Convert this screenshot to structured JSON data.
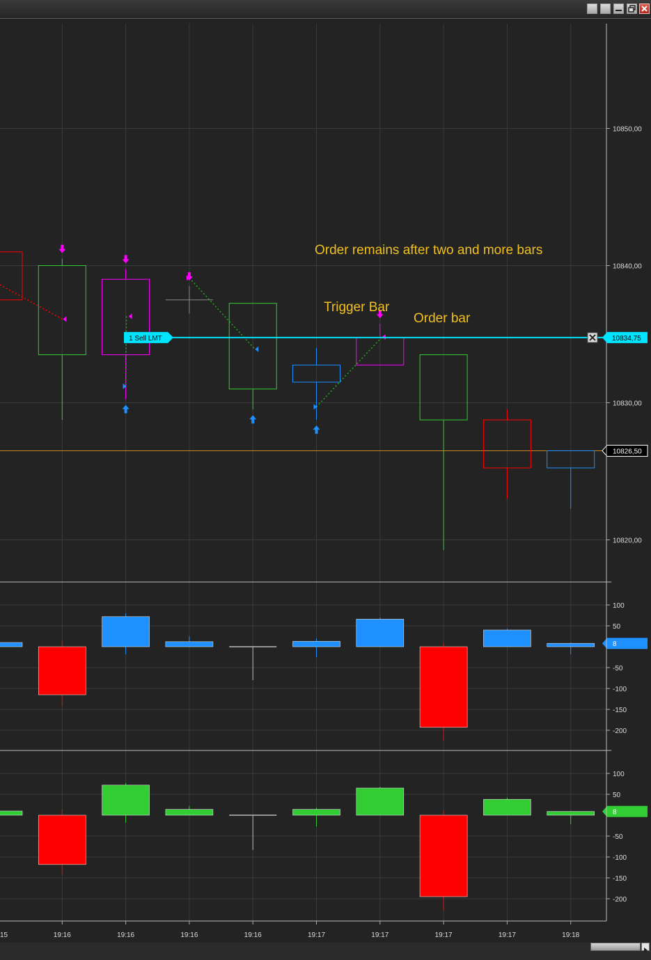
{
  "window": {
    "buttons": [
      "maximize-a",
      "maximize-b",
      "minimize",
      "restore",
      "close"
    ]
  },
  "colors": {
    "background": "#232323",
    "grid": "#3a3a3a",
    "up": "#32cd32",
    "down": "#ff0000",
    "blue": "#1e90ff",
    "magenta": "#ff00ff",
    "order_line": "#00e5ff",
    "annotation": "#f0c020",
    "last_price_line": "#c8841e"
  },
  "time_axis": {
    "labels": [
      "15",
      "19:16",
      "19:16",
      "19:16",
      "19:16",
      "19:17",
      "19:17",
      "19:17",
      "19:17",
      "19:18"
    ]
  },
  "price_axis": {
    "labels": [
      "10850,00",
      "10840,00",
      "10830,00",
      "10820,00"
    ],
    "ticks": [
      10850,
      10840,
      10830,
      10820
    ]
  },
  "annotations": {
    "order_remains": "Order remains after two and more bars",
    "trigger_bar": "Trigger Bar",
    "order_bar": "Order bar"
  },
  "order": {
    "label": "1  Sell LMT",
    "price": 10834.75,
    "price_label": "10834,75"
  },
  "last_price": {
    "value": 10826.5,
    "label": "10826,50"
  },
  "chart_data": [
    {
      "type": "candlestick",
      "name": "price",
      "x": [
        "15",
        "19:16",
        "19:16",
        "19:16",
        "19:16",
        "19:17",
        "19:17",
        "19:17",
        "19:17",
        "19:18"
      ],
      "bars": [
        {
          "open": 10837.5,
          "close": 10841,
          "high": 10841,
          "low": 10837.5,
          "color": "red"
        },
        {
          "open": 10833.5,
          "close": 10840,
          "high": 10840.5,
          "low": 10828.75,
          "color": "green"
        },
        {
          "open": 10839,
          "close": 10833.5,
          "high": 10839.75,
          "low": 10830.25,
          "color": "magenta"
        },
        {
          "open": 10837.5,
          "close": 10837.5,
          "high": 10838.5,
          "low": 10836.5,
          "color": "gray"
        },
        {
          "open": 10831,
          "close": 10837.25,
          "high": 10837.25,
          "low": 10829.5,
          "color": "green"
        },
        {
          "open": 10831.5,
          "close": 10832.75,
          "high": 10834,
          "low": 10828.75,
          "color": "blue"
        },
        {
          "open": 10832.75,
          "close": 10834.75,
          "high": 10835.75,
          "low": 10832.75,
          "color": "magenta"
        },
        {
          "open": 10828.75,
          "close": 10833.5,
          "high": 10833.5,
          "low": 10819.25,
          "color": "green"
        },
        {
          "open": 10825.25,
          "close": 10828.75,
          "high": 10829.5,
          "low": 10823,
          "color": "red"
        },
        {
          "open": 10825.25,
          "close": 10826.5,
          "high": 10826.5,
          "low": 10822.25,
          "color": "blue"
        }
      ],
      "markers": [
        {
          "bar": 1,
          "kind": "down-arrow"
        },
        {
          "bar": 2,
          "kind": "down-arrow"
        },
        {
          "bar": 3,
          "kind": "down-arrow"
        },
        {
          "bar": 6,
          "kind": "down-arrow"
        },
        {
          "bar": 2,
          "kind": "up-arrow"
        },
        {
          "bar": 4,
          "kind": "up-arrow"
        },
        {
          "bar": 5,
          "kind": "up-arrow"
        }
      ],
      "ylim": [
        10815.75,
        10857.5
      ]
    },
    {
      "type": "bar",
      "name": "oscillator-1",
      "x": [
        "15",
        "19:16",
        "19:16",
        "19:16",
        "19:16",
        "19:17",
        "19:17",
        "19:17",
        "19:17",
        "19:18"
      ],
      "values": [
        10,
        -115,
        72,
        12,
        -2,
        13,
        66,
        -193,
        40,
        8
      ],
      "wicks_high": [
        10,
        15,
        80,
        25,
        0,
        20,
        70,
        10,
        43,
        10
      ],
      "wicks_low": [
        0,
        -143,
        -18,
        0,
        -80,
        -25,
        0,
        -225,
        0,
        -18
      ],
      "ticks": [
        100,
        50,
        -50,
        -100,
        -150,
        -200
      ],
      "tick_labels": [
        "100",
        "50",
        "-50",
        "-100",
        "-150",
        "-200"
      ],
      "current_label": "8",
      "colors": {
        "positive": "#1e90ff",
        "negative": "#ff0000"
      },
      "ylim": [
        -260,
        120
      ]
    },
    {
      "type": "bar",
      "name": "oscillator-2",
      "x": [
        "15",
        "19:16",
        "19:16",
        "19:16",
        "19:16",
        "19:17",
        "19:17",
        "19:17",
        "19:17",
        "19:18"
      ],
      "values": [
        10,
        -118,
        72,
        14,
        -2,
        14,
        65,
        -195,
        38,
        9
      ],
      "wicks_high": [
        10,
        15,
        77,
        22,
        0,
        18,
        68,
        10,
        42,
        10
      ],
      "wicks_low": [
        0,
        -143,
        -18,
        0,
        -83,
        -27,
        0,
        -228,
        0,
        -22
      ],
      "ticks": [
        100,
        50,
        -50,
        -100,
        -150,
        -200
      ],
      "tick_labels": [
        "100",
        "50",
        "-50",
        "-100",
        "-150",
        "-200"
      ],
      "current_label": "8",
      "colors": {
        "positive": "#32cd32",
        "negative": "#ff0000"
      },
      "ylim": [
        -260,
        120
      ]
    }
  ]
}
